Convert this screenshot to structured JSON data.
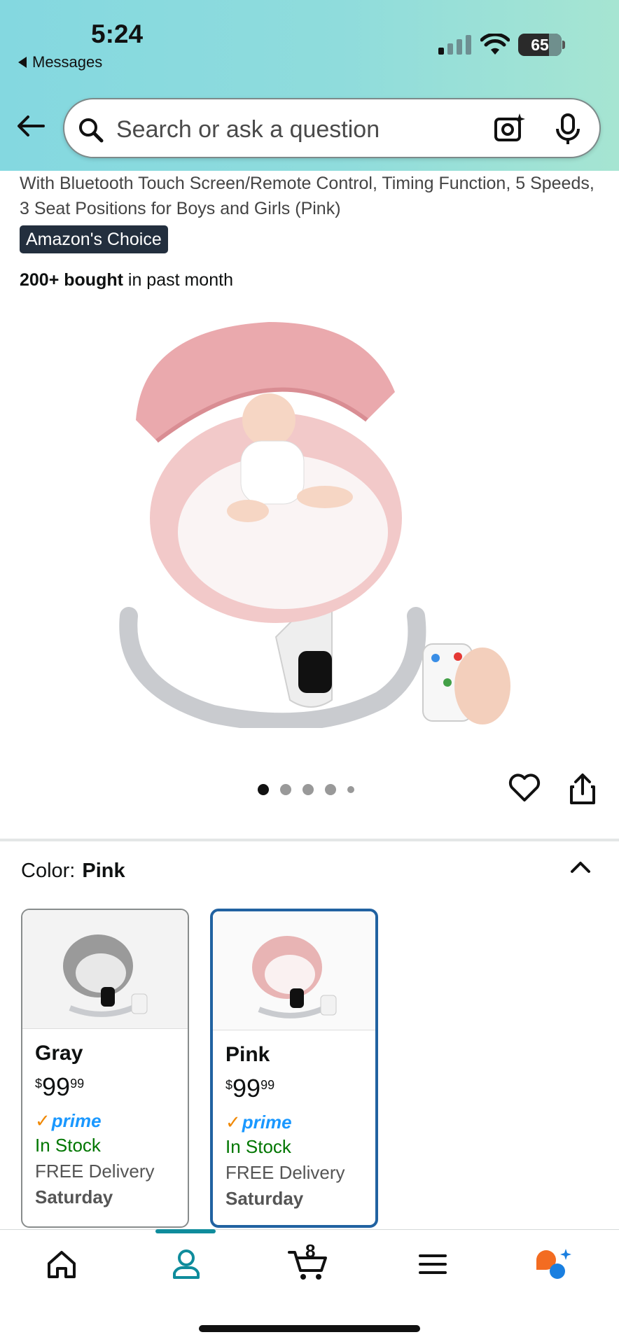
{
  "status_bar": {
    "time": "5:24",
    "back_app": "Messages",
    "battery": "65"
  },
  "search": {
    "placeholder": "Search or ask a question"
  },
  "product": {
    "title": "With Bluetooth Touch Screen/Remote Control, Timing Function, 5 Speeds, 3 Seat Positions for Boys and Girls (Pink)",
    "badge": "Amazon's Choice",
    "bought_bold": "200+ bought",
    "bought_rest": " in past month",
    "image_name": "pink baby swing with remote"
  },
  "gallery": {
    "dot_count": 5,
    "active_index": 0
  },
  "color": {
    "label": "Color:",
    "value": "Pink"
  },
  "swatches": [
    {
      "name": "Gray",
      "currency": "$",
      "price_whole": "99",
      "price_frac": "99",
      "prime": "prime",
      "stock": "In Stock",
      "delivery": "FREE Delivery",
      "day": "Saturday",
      "selected": false,
      "accent": "#9a9a9a"
    },
    {
      "name": "Pink",
      "currency": "$",
      "price_whole": "99",
      "price_frac": "99",
      "prime": "prime",
      "stock": "In Stock",
      "delivery": "FREE Delivery",
      "day": "Saturday",
      "selected": true,
      "accent": "#e8b4b4"
    }
  ],
  "tabbar": {
    "cart_count": "8",
    "active_tab": "account"
  },
  "colors": {
    "selected_border": "#2162a1",
    "in_stock": "#007600",
    "prime_blue": "#1a98ff",
    "badge_bg": "#232f3e",
    "tab_accent": "#0f8c9c"
  }
}
